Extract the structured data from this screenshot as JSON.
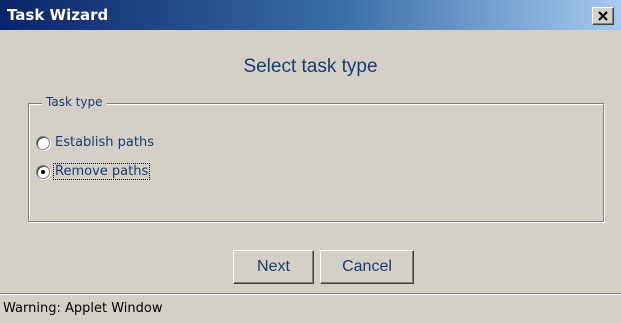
{
  "window": {
    "title": "Task Wizard",
    "close_glyph": "close-icon"
  },
  "main": {
    "heading": "Select task type"
  },
  "task_type_group": {
    "legend": "Task type",
    "options": [
      {
        "label": "Establish paths",
        "selected": false
      },
      {
        "label": "Remove paths",
        "selected": true
      }
    ]
  },
  "buttons": {
    "next_label": "Next",
    "cancel_label": "Cancel"
  },
  "status_bar": {
    "text": "Warning: Applet Window"
  },
  "colors": {
    "title_gradient_start": "#0a246a",
    "title_gradient_end": "#a6caf0",
    "face": "#d4d0c8",
    "label_text": "#183c6e"
  }
}
